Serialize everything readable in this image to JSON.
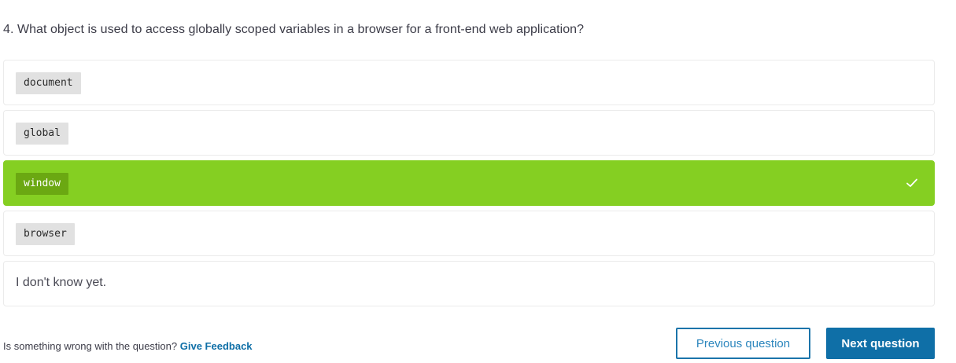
{
  "question": {
    "text": "4. What object is used to access globally scoped variables in a browser for a front-end web application?"
  },
  "options": [
    {
      "label": "document",
      "style": "code",
      "selected": false
    },
    {
      "label": "global",
      "style": "code",
      "selected": false
    },
    {
      "label": "window",
      "style": "code",
      "selected": true
    },
    {
      "label": "browser",
      "style": "code",
      "selected": false
    },
    {
      "label": "I don't know yet.",
      "style": "text",
      "selected": false
    }
  ],
  "footer": {
    "prompt": "Is something wrong with the question?",
    "feedback_link": "Give Feedback"
  },
  "buttons": {
    "previous": "Previous question",
    "next": "Next question"
  },
  "colors": {
    "selected_bg": "#85cf22",
    "primary": "#0f6fa7",
    "pill_bg": "#e1e1e1"
  },
  "icons": {
    "selected_indicator": "check-icon"
  }
}
